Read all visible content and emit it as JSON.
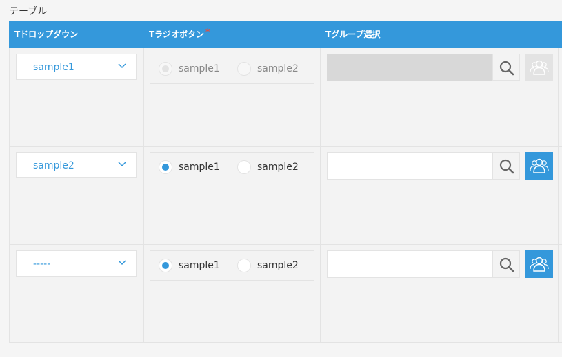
{
  "section_title": "テーブル",
  "colors": {
    "header_bg": "#3498db",
    "accent": "#3498db",
    "required": "#e74c3c"
  },
  "columns": {
    "dropdown": "Tドロップダウン",
    "radio": "Tラジオボタン",
    "radio_required_mark": "*",
    "group": "Tグループ選択"
  },
  "rows": [
    {
      "dropdown_value": "sample1",
      "radio_options": [
        "sample1",
        "sample2"
      ],
      "radio_selected": 0,
      "radio_disabled": true,
      "group_disabled": true
    },
    {
      "dropdown_value": "sample2",
      "radio_options": [
        "sample1",
        "sample2"
      ],
      "radio_selected": 0,
      "radio_disabled": false,
      "group_disabled": false
    },
    {
      "dropdown_value": "-----",
      "radio_options": [
        "sample1",
        "sample2"
      ],
      "radio_selected": 0,
      "radio_disabled": false,
      "group_disabled": false
    }
  ],
  "icons": {
    "dropdown": "chevron-down-icon",
    "search": "search-icon",
    "group": "group-icon"
  }
}
